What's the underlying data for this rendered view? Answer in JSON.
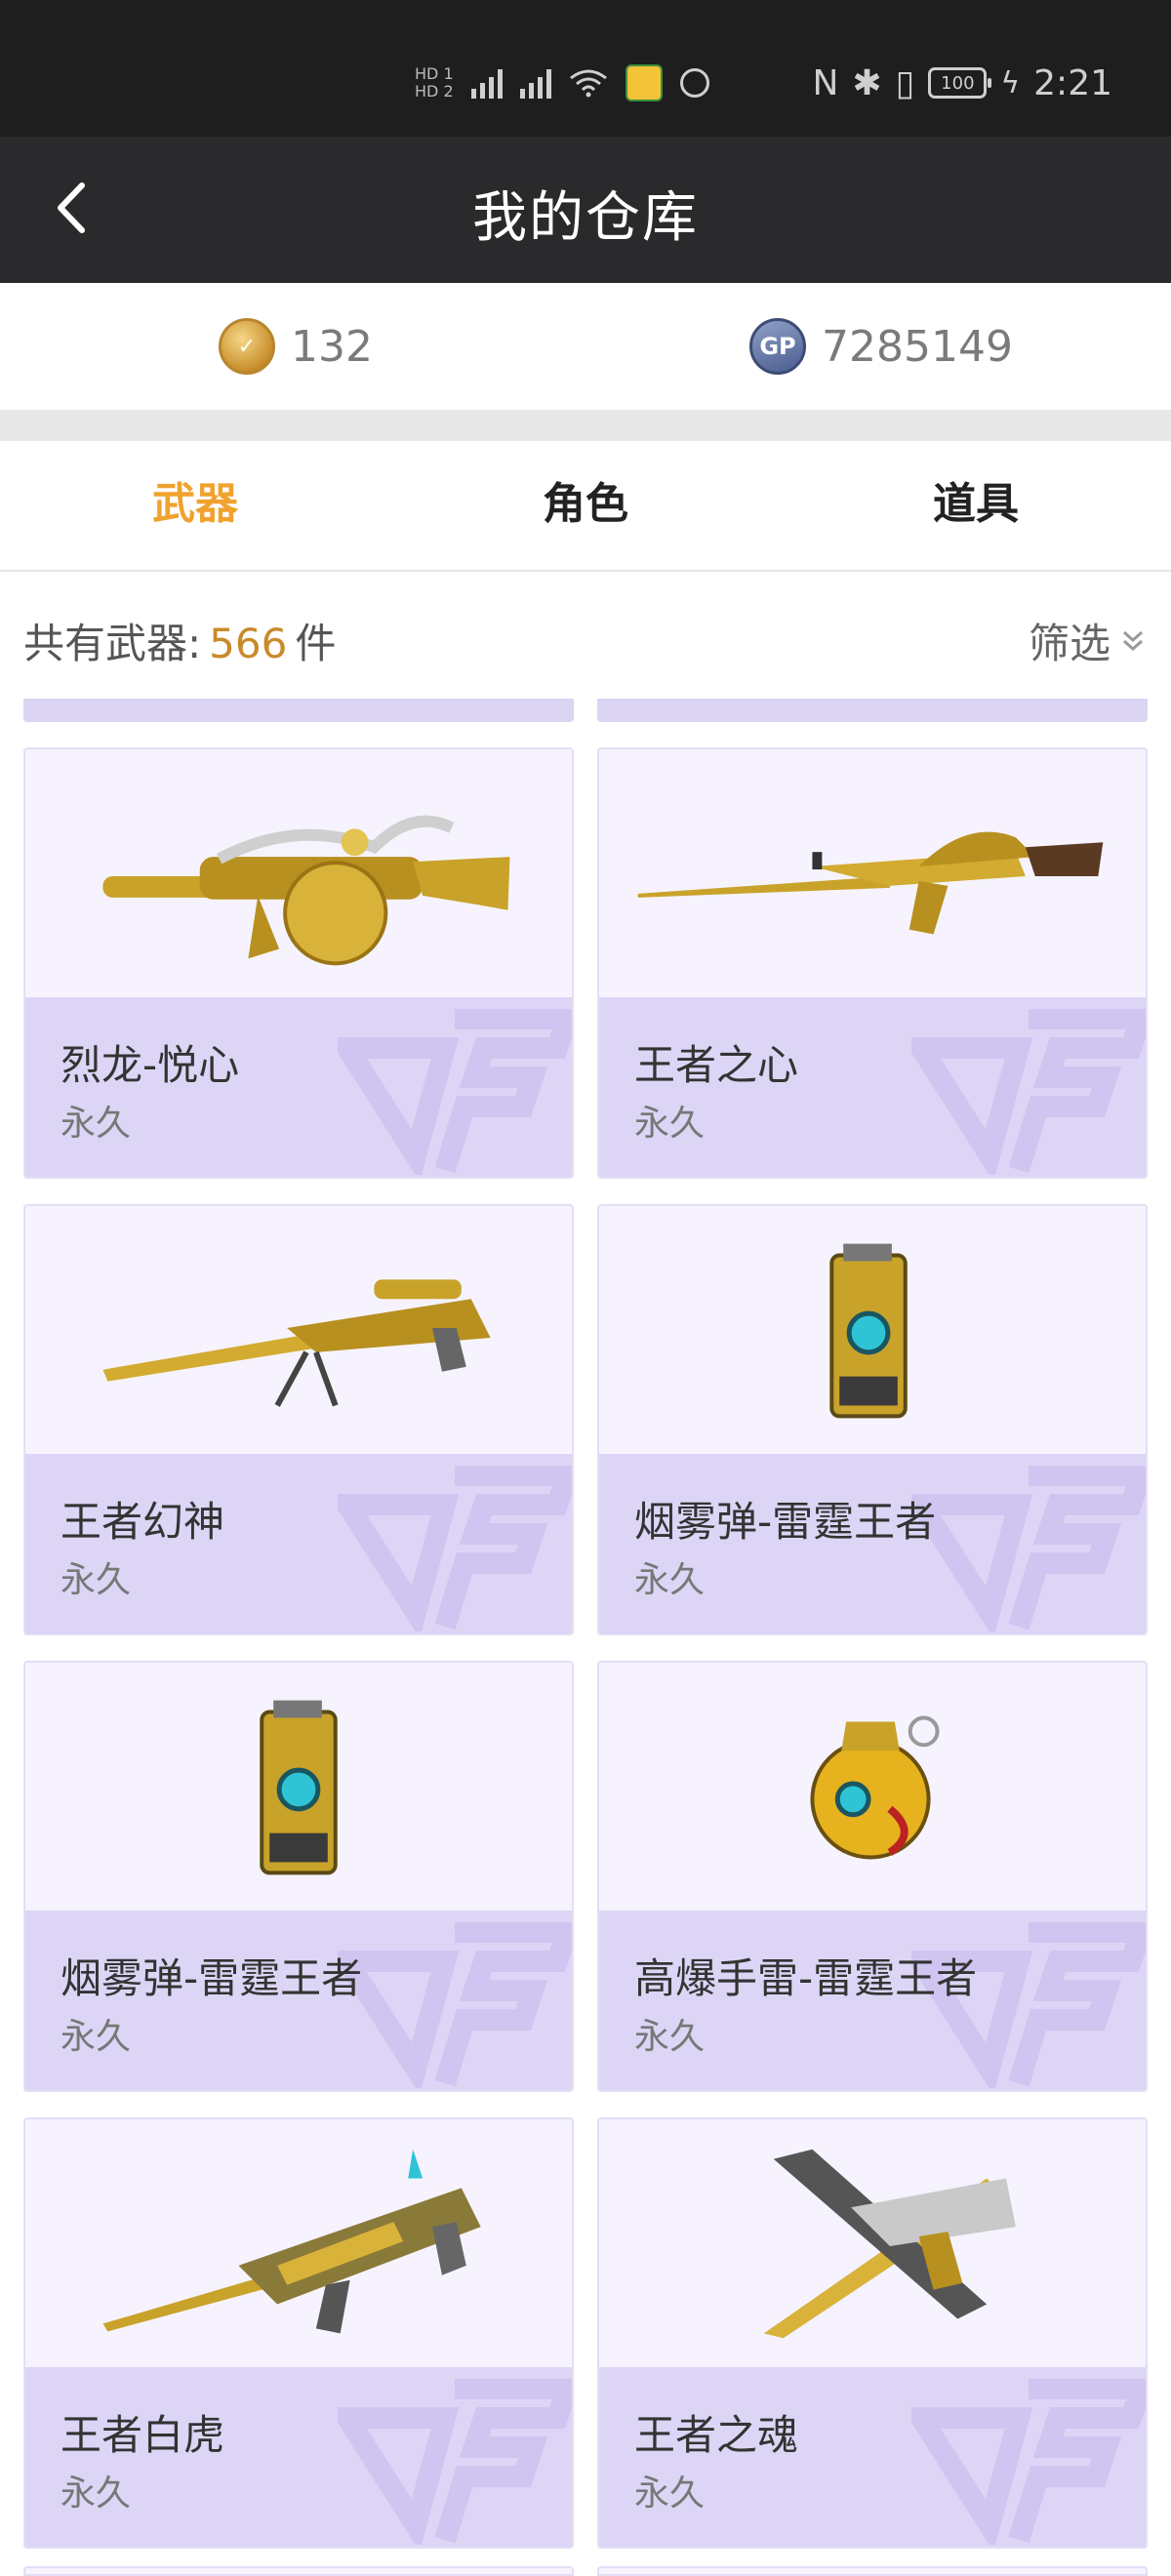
{
  "status_bar": {
    "signal_labels": [
      "HD 1",
      "HD 2"
    ],
    "battery": "100",
    "time": "2:21"
  },
  "nav": {
    "title": "我的仓库",
    "back_icon": "chevron-left-icon"
  },
  "currency": {
    "cf_points": "132",
    "gp_points": "7285149",
    "gp_label": "GP"
  },
  "tabs": [
    {
      "label": "武器",
      "active": true
    },
    {
      "label": "角色",
      "active": false
    },
    {
      "label": "道具",
      "active": false
    }
  ],
  "summary": {
    "prefix": "共有武器:",
    "count": "566",
    "suffix": "件",
    "filter_label": "筛选"
  },
  "items": [
    {
      "name": "烈龙-悦心",
      "duration": "永久",
      "icon": "drum-smg-icon"
    },
    {
      "name": "王者之心",
      "duration": "永久",
      "icon": "assault-rifle-icon"
    },
    {
      "name": "王者幻神",
      "duration": "永久",
      "icon": "sniper-rifle-icon"
    },
    {
      "name": "烟雾弹-雷霆王者",
      "duration": "永久",
      "icon": "smoke-grenade-icon"
    },
    {
      "name": "烟雾弹-雷霆王者",
      "duration": "永久",
      "icon": "smoke-grenade-icon"
    },
    {
      "name": "高爆手雷-雷霆王者",
      "duration": "永久",
      "icon": "frag-grenade-icon"
    },
    {
      "name": "王者白虎",
      "duration": "永久",
      "icon": "tiger-rifle-icon"
    },
    {
      "name": "王者之魂",
      "duration": "永久",
      "icon": "pistol-knife-icon"
    }
  ],
  "colors": {
    "accent": "#f0a22e",
    "card_bg": "#f6f3ff",
    "card_lower": "#ddd5f5",
    "nav_bg": "#2a2a2c"
  }
}
